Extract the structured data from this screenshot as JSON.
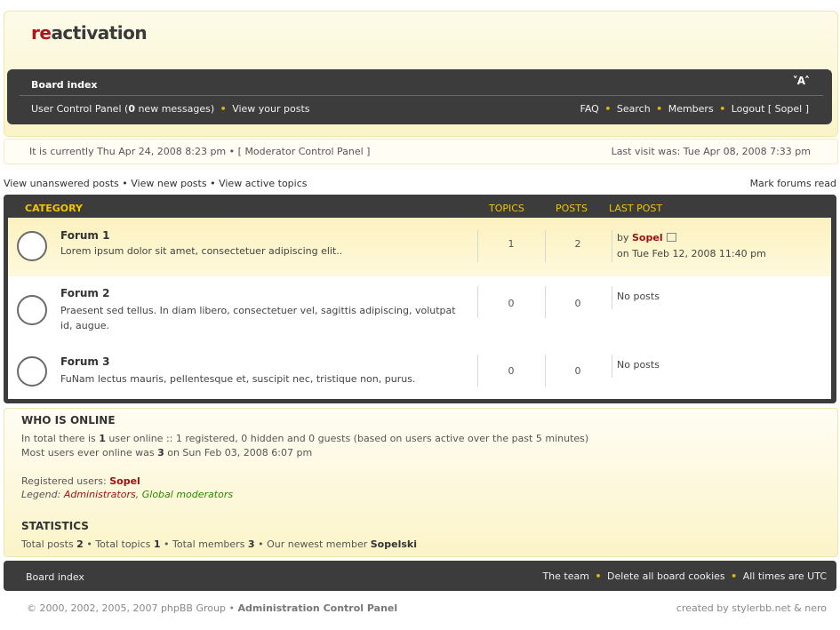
{
  "logo": {
    "prefix": "re",
    "rest": "activation"
  },
  "nav": {
    "board_index": "Board index",
    "font_toggle": "˅A˄",
    "ucp": "User Control Panel",
    "new_messages_open": " (",
    "new_messages_count": "0",
    "new_messages_text": " new messages)",
    "view_posts": "View your posts",
    "faq": "FAQ",
    "search": "Search",
    "members": "Members",
    "logout": "Logout",
    "logout_user": "[ Sopel ]"
  },
  "info": {
    "current_time": "It is currently Thu Apr 24, 2008 8:23 pm",
    "mcp": "[ Moderator Control Panel ]",
    "last_visit": "Last visit was: Tue Apr 08, 2008 7:33 pm"
  },
  "links": {
    "unanswered": "View unanswered posts",
    "new_posts": "View new posts",
    "active": "View active topics",
    "mark_read": "Mark forums read"
  },
  "table": {
    "headers": {
      "category": "CATEGORY",
      "topics": "TOPICS",
      "posts": "POSTS",
      "last_post": "LAST POST"
    },
    "forums": [
      {
        "title": "Forum 1",
        "desc": "Lorem ipsum dolor sit amet, consectetuer adipiscing elit..",
        "topics": "1",
        "posts": "2",
        "last_by": "by ",
        "last_user": "Sopel",
        "last_date": "on Tue Feb 12, 2008 11:40 pm"
      },
      {
        "title": "Forum 2",
        "desc": "Praesent sed tellus. In diam libero, consectetuer vel, sagittis adipiscing, volutpat id, augue.",
        "topics": "0",
        "posts": "0",
        "last_text": "No posts"
      },
      {
        "title": "Forum 3",
        "desc": "FuNam lectus mauris, pellentesque et, suscipit nec, tristique non, purus.",
        "topics": "0",
        "posts": "0",
        "last_text": "No posts"
      }
    ]
  },
  "online": {
    "title": "WHO IS ONLINE",
    "line1_a": "In total there is ",
    "line1_count": "1",
    "line1_b": " user online :: 1 registered, 0 hidden and 0 guests (based on users active over the past 5 minutes)",
    "line2_a": "Most users ever online was ",
    "line2_count": "3",
    "line2_b": " on Sun Feb 03, 2008 6:07 pm",
    "registered_label": "Registered users: ",
    "registered_user": "Sopel",
    "legend_label": "Legend: ",
    "legend_admin": "Administrators",
    "legend_comma": ", ",
    "legend_gmod": "Global moderators"
  },
  "stats": {
    "title": "STATISTICS",
    "posts_label": "Total posts ",
    "posts": "2",
    "topics_label": "Total topics ",
    "topics": "1",
    "members_label": "Total members ",
    "members": "3",
    "newest_label": "Our newest member ",
    "newest": "Sopelski"
  },
  "footer": {
    "board_index": "Board index",
    "team": "The team",
    "cookies": "Delete all board cookies",
    "times": "All times are UTC",
    "copyright": "© 2000, 2002, 2005, 2007 phpBB Group",
    "acp": "Administration Control Panel",
    "credit": "created by stylerbb.net & nero"
  },
  "colors": {
    "dark": "#3c3c3c",
    "accent": "#f5c400",
    "user": "#9a1111",
    "gmod": "#2a8a00"
  }
}
